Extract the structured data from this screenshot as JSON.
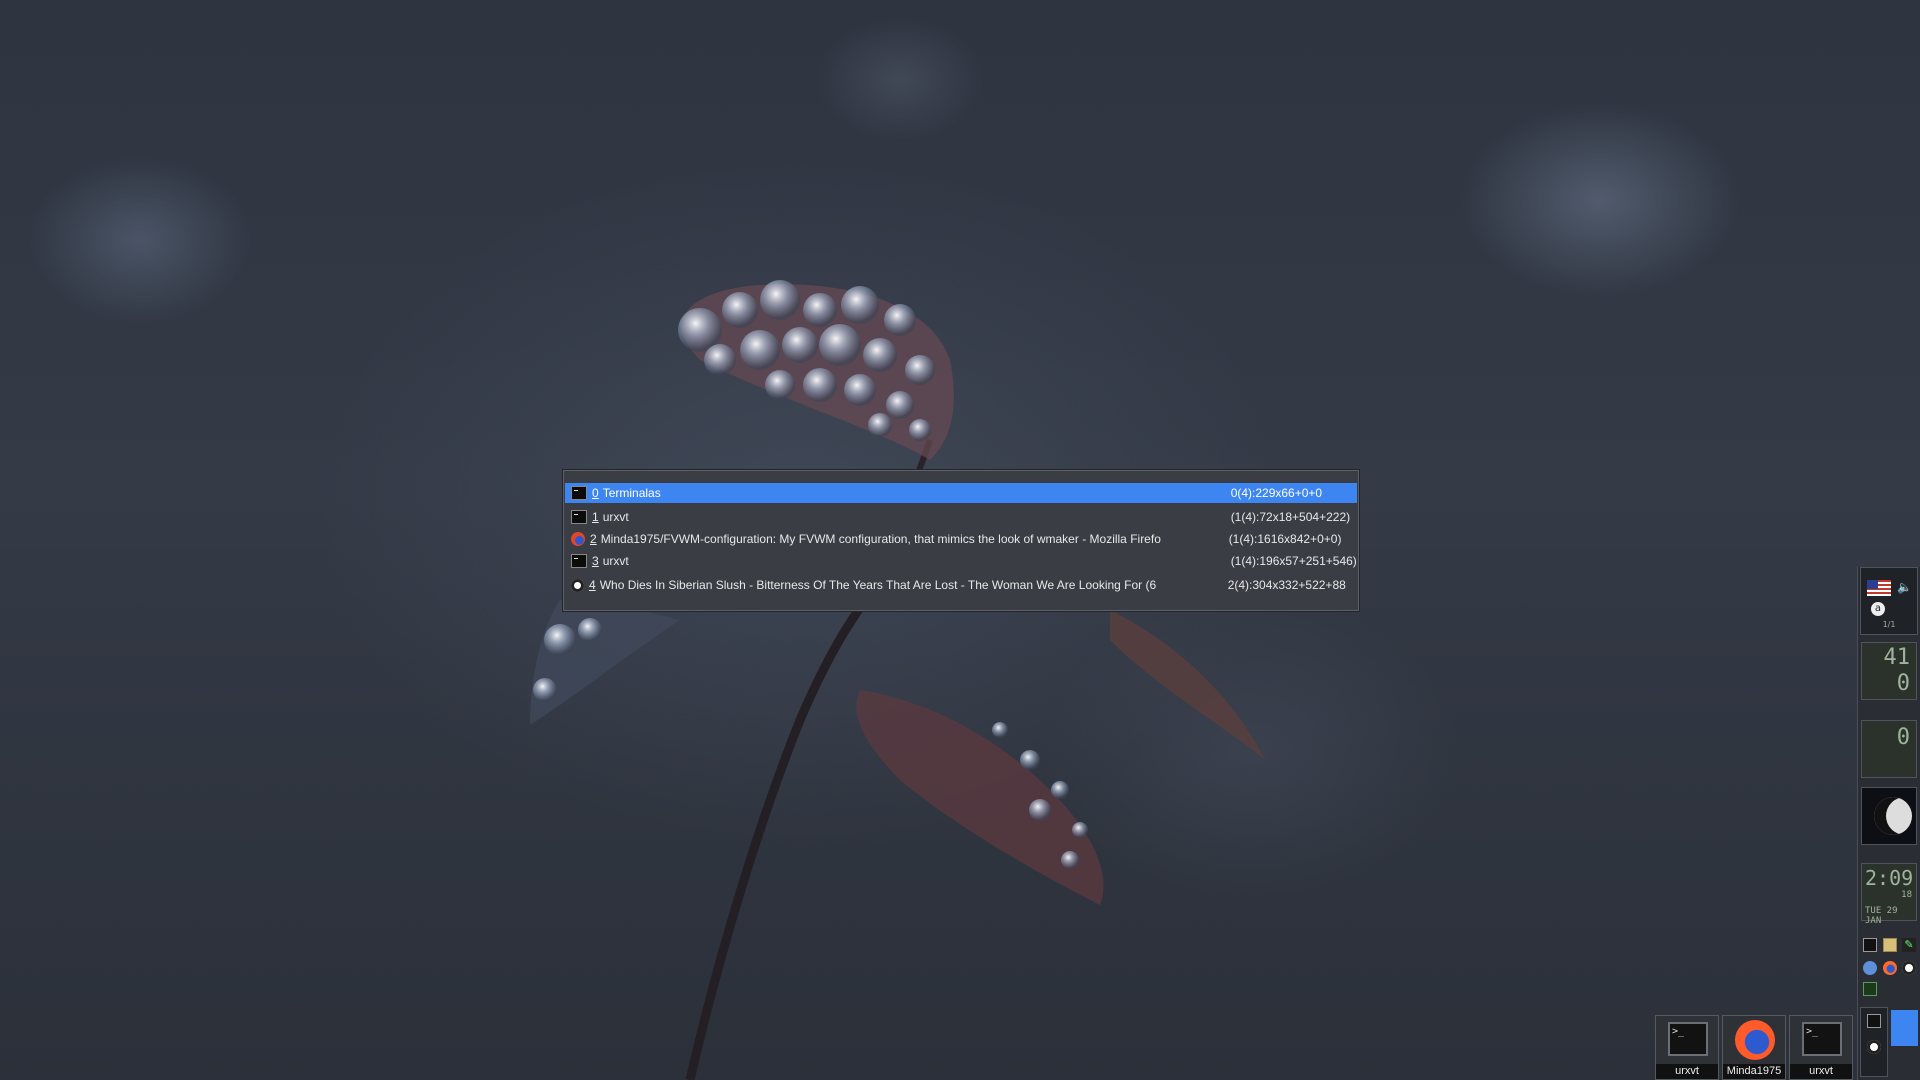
{
  "window_list": {
    "rows": [
      {
        "num": "0",
        "title": "Terminalas",
        "geometry": "0(4):229x66+0+0",
        "icon": "terminal-icon",
        "selected": true
      },
      {
        "num": "1",
        "title": "urxvt",
        "geometry": "(1(4):72x18+504+222)",
        "icon": "terminal-icon",
        "selected": false
      },
      {
        "num": "2",
        "title": "Minda1975/FVWM-configuration: My FVWM configuration, that mimics the look of wmaker - Mozilla Firefo",
        "geometry": "(1(4):1616x842+0+0)",
        "icon": "firefox-icon",
        "selected": false
      },
      {
        "num": "3",
        "title": "urxvt",
        "geometry": "(1(4):196x57+251+546)",
        "icon": "terminal-icon",
        "selected": false
      },
      {
        "num": "4",
        "title": "Who Dies In Siberian Slush - Bitterness Of The Years That Are Lost - The Woman We Are Looking For (6",
        "geometry": "2(4):304x332+522+88",
        "icon": "music-player-icon",
        "selected": false
      }
    ]
  },
  "dock": {
    "pager_label": "1/1",
    "memory_top": "41",
    "memory_bottom": "0",
    "cpu": "0",
    "clock_time": "2:09",
    "clock_seconds": "18",
    "clock_date": "TUE 29 JAN"
  },
  "taskbar": {
    "items": [
      {
        "label": "urxvt",
        "icon": "terminal-icon"
      },
      {
        "label": "Minda1975",
        "icon": "firefox-icon"
      },
      {
        "label": "urxvt",
        "icon": "terminal-icon"
      }
    ]
  },
  "colors": {
    "selection": "#3d85f0",
    "popup_bg": "#3a3d44",
    "dock_bg": "#2a2d33"
  }
}
